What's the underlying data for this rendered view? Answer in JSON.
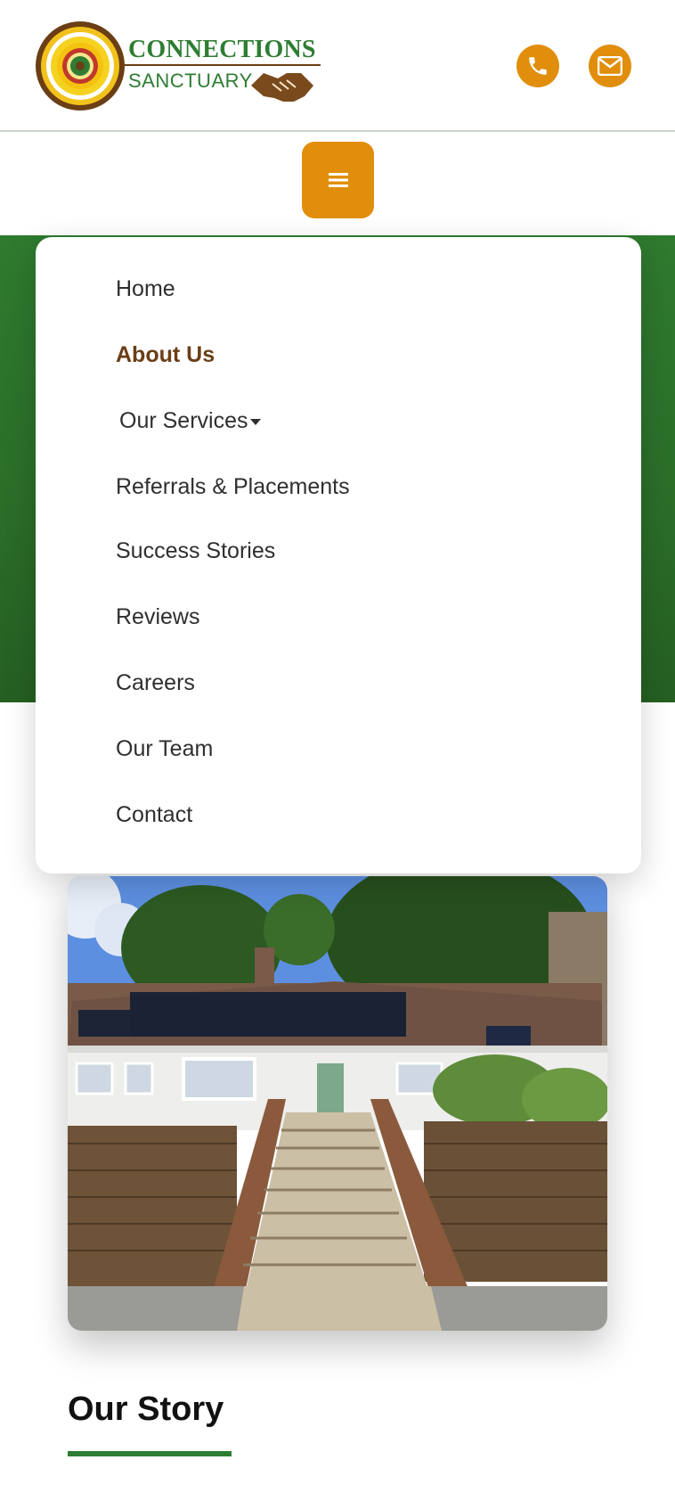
{
  "brand": {
    "line1": "CONNECTIONS",
    "line2": "SANCTUARY"
  },
  "header": {
    "phone_icon": "phone-icon",
    "mail_icon": "mail-icon",
    "menu_icon": "menu-icon"
  },
  "colors": {
    "accent": "#e08e0b",
    "green": "#2e7d32",
    "brown": "#6b3e16"
  },
  "menu": {
    "items": [
      {
        "label": "Home"
      },
      {
        "label": "About Us",
        "active": true
      },
      {
        "label": "Our Services",
        "has_dropdown": true
      },
      {
        "label": "Referrals & Placements"
      },
      {
        "label": "Success Stories"
      },
      {
        "label": "Reviews"
      },
      {
        "label": "Careers"
      },
      {
        "label": "Our Team"
      },
      {
        "label": "Contact"
      }
    ]
  },
  "content": {
    "story_title": "Our Story"
  }
}
